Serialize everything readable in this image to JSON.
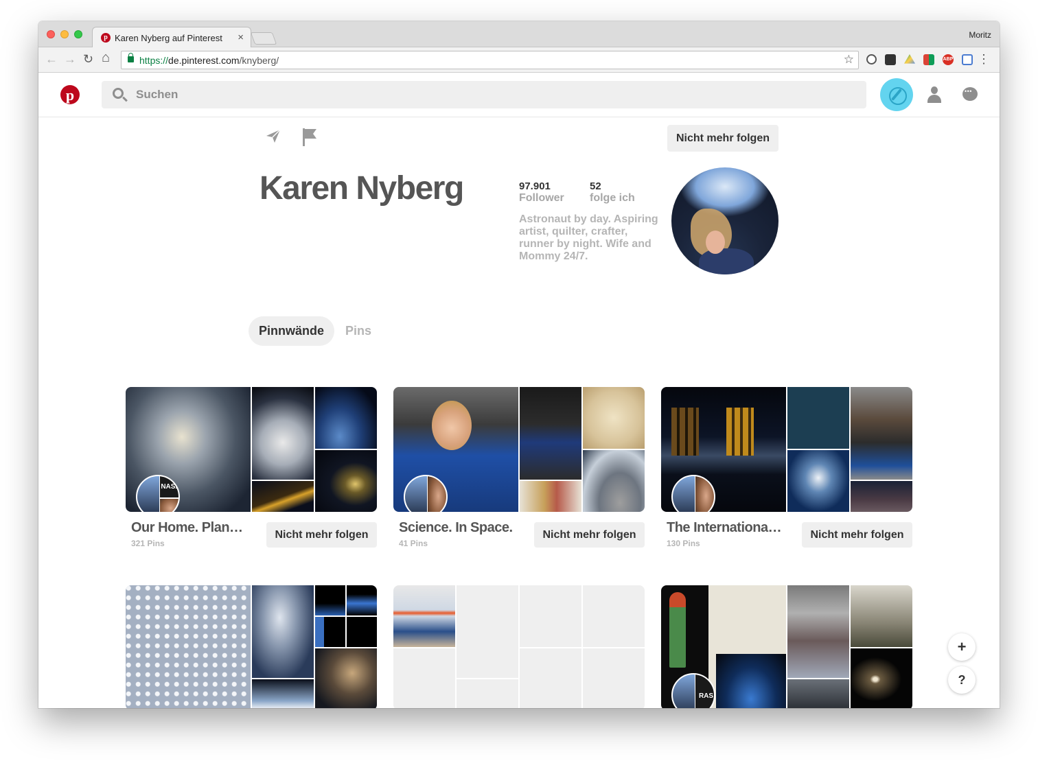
{
  "browser": {
    "tab_title": "Karen Nyberg auf Pinterest",
    "tab_close": "×",
    "profile_user": "Moritz",
    "url_scheme": "https://",
    "url_host": "de.pinterest.com",
    "url_path": "/knyberg/",
    "star": "☆",
    "menu": "⋮",
    "back": "←",
    "forward": "→",
    "reload": "↻",
    "home": "⌂"
  },
  "pinterest": {
    "logo": "p",
    "search_placeholder": "Suchen",
    "brand_color": "#bd081c"
  },
  "profile": {
    "name": "Karen Nyberg",
    "unfollow_label": "Nicht mehr folgen",
    "followers_count": "97.901",
    "followers_label": "Follower",
    "following_count": "52",
    "following_label": "folge ich",
    "bio": "Astronaut by day. Aspiring artist, quilter, crafter, runner by night. Wife and Mommy 24/7."
  },
  "tabs": [
    {
      "label": "Pinnwände",
      "active": true
    },
    {
      "label": "Pins",
      "active": false
    }
  ],
  "boards": [
    {
      "title": "Our Home. Plan…",
      "count": "321 Pins",
      "button": "Nicht mehr folgen"
    },
    {
      "title": "Science. In Space.",
      "count": "41 Pins",
      "button": "Nicht mehr folgen"
    },
    {
      "title": "The Internationa…",
      "count": "130 Pins",
      "button": "Nicht mehr folgen"
    }
  ],
  "fab": {
    "add": "+",
    "help": "?"
  }
}
